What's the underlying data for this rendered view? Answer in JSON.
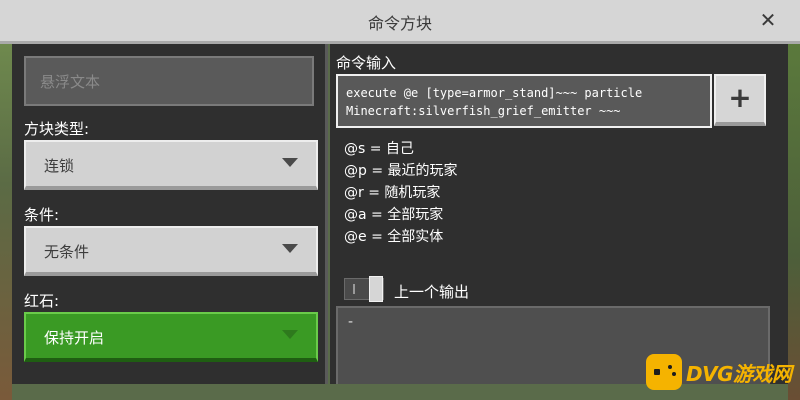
{
  "window": {
    "title": "命令方块"
  },
  "left": {
    "hover_placeholder": "悬浮文本",
    "block_type": {
      "label": "方块类型:",
      "value": "连锁"
    },
    "condition": {
      "label": "条件:",
      "value": "无条件"
    },
    "redstone": {
      "label": "红石:",
      "value": "保持开启"
    }
  },
  "right": {
    "command_label": "命令输入",
    "command_value": "execute @e [type=armor_stand]~~~ particle\nMinecraft:silverfish_grief_emitter ~~~",
    "add_button": "+",
    "help": [
      "@s = 自己",
      "@p = 最近的玩家",
      "@r = 随机玩家",
      "@a = 全部玩家",
      "@e = 全部实体"
    ],
    "prev_output_label": "上一个输出",
    "output_value": "-"
  },
  "watermark": {
    "text": "DVG游戏网"
  },
  "colors": {
    "green": "#3a9a24",
    "accent_watermark": "#f5b300"
  }
}
